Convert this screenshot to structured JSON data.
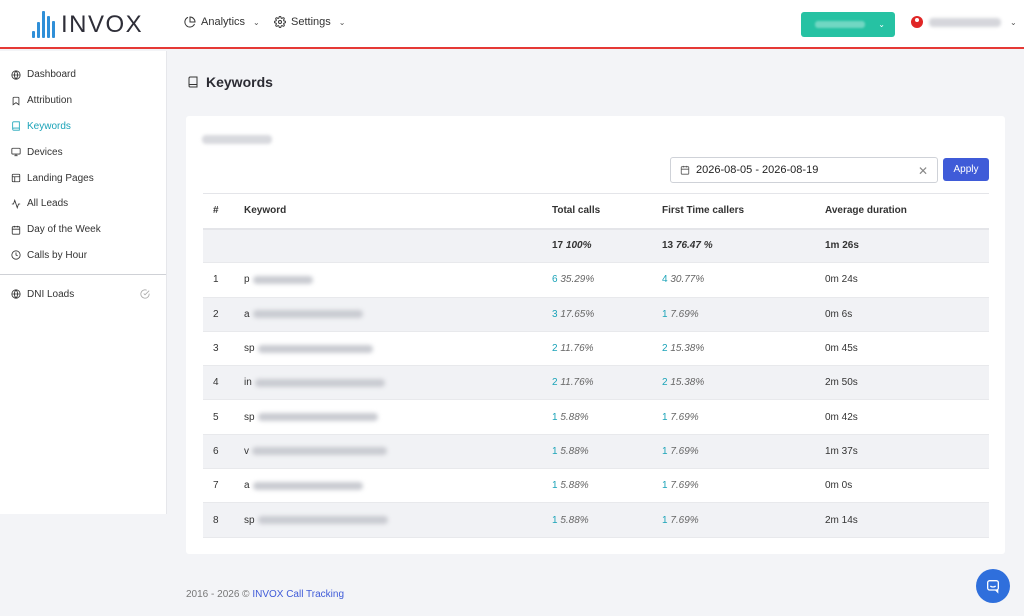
{
  "header": {
    "logo_text": "INVOX",
    "nav": [
      {
        "label": "Analytics",
        "icon": "pie-chart-icon"
      },
      {
        "label": "Settings",
        "icon": "gear-icon"
      }
    ],
    "accent_color": "#26c2a3",
    "border_color": "#e53935"
  },
  "sidebar": {
    "items": [
      {
        "label": "Dashboard",
        "icon": "globe-icon"
      },
      {
        "label": "Attribution",
        "icon": "bookmark-icon"
      },
      {
        "label": "Keywords",
        "icon": "book-icon",
        "active": true
      },
      {
        "label": "Devices",
        "icon": "monitor-icon"
      },
      {
        "label": "Landing Pages",
        "icon": "layout-icon"
      },
      {
        "label": "All Leads",
        "icon": "activity-icon"
      },
      {
        "label": "Day of the Week",
        "icon": "calendar-icon"
      },
      {
        "label": "Calls by Hour",
        "icon": "clock-icon"
      }
    ],
    "secondary": [
      {
        "label": "DNI Loads",
        "icon": "globe-icon"
      }
    ],
    "active_color": "#1aa3b8"
  },
  "page": {
    "title": "Keywords",
    "date_range": "2026-08-05 - 2026-08-19",
    "apply_label": "Apply"
  },
  "table": {
    "headers": [
      "#",
      "Keyword",
      "Total calls",
      "First Time callers",
      "Average duration"
    ],
    "summary": {
      "total_calls": "17",
      "total_pct": "100%",
      "ftc": "13",
      "ftc_pct": "76.47 %",
      "avg": "1m 26s"
    },
    "rows": [
      {
        "n": "1",
        "kw": "p",
        "tot": "6",
        "tot_pct": "35.29%",
        "ftc": "4",
        "ftc_pct": "30.77%",
        "avg": "0m 24s"
      },
      {
        "n": "2",
        "kw": "a",
        "tot": "3",
        "tot_pct": "17.65%",
        "ftc": "1",
        "ftc_pct": "7.69%",
        "avg": "0m 6s"
      },
      {
        "n": "3",
        "kw": "sp",
        "tot": "2",
        "tot_pct": "11.76%",
        "ftc": "2",
        "ftc_pct": "15.38%",
        "avg": "0m 45s"
      },
      {
        "n": "4",
        "kw": "in",
        "tot": "2",
        "tot_pct": "11.76%",
        "ftc": "2",
        "ftc_pct": "15.38%",
        "avg": "2m 50s"
      },
      {
        "n": "5",
        "kw": "sp",
        "tot": "1",
        "tot_pct": "5.88%",
        "ftc": "1",
        "ftc_pct": "7.69%",
        "avg": "0m 42s"
      },
      {
        "n": "6",
        "kw": "v",
        "tot": "1",
        "tot_pct": "5.88%",
        "ftc": "1",
        "ftc_pct": "7.69%",
        "avg": "1m 37s"
      },
      {
        "n": "7",
        "kw": "a",
        "tot": "1",
        "tot_pct": "5.88%",
        "ftc": "1",
        "ftc_pct": "7.69%",
        "avg": "0m 0s"
      },
      {
        "n": "8",
        "kw": "sp",
        "tot": "1",
        "tot_pct": "5.88%",
        "ftc": "1",
        "ftc_pct": "7.69%",
        "avg": "2m 14s"
      }
    ]
  },
  "footer": {
    "prefix": "2016 - 2026 ©",
    "brand": "INVOX Call Tracking"
  }
}
